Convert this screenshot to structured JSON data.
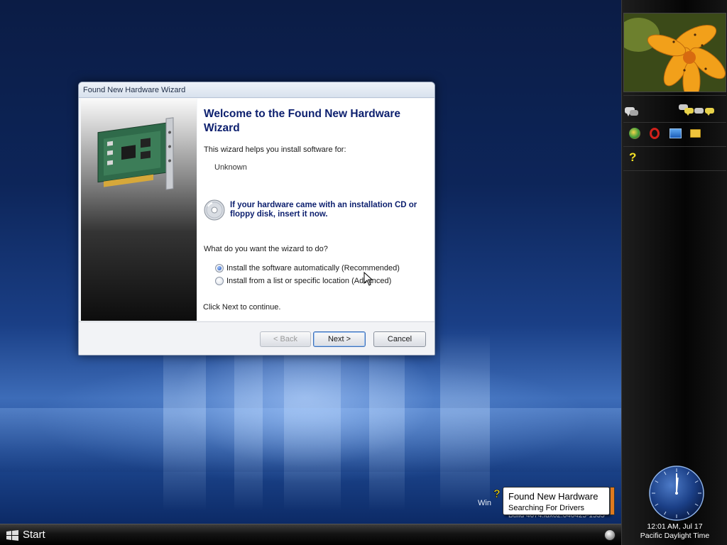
{
  "wizard": {
    "title": "Found New Hardware Wizard",
    "heading": "Welcome to the Found New Hardware Wizard",
    "intro": "This wizard helps you install software for:",
    "device_name": "Unknown",
    "cd_prompt": "If your hardware came with an installation CD or floppy disk, insert it now.",
    "question": "What do you want the wizard to do?",
    "options": [
      {
        "label": "Install the software automatically (Recommended)",
        "selected": true
      },
      {
        "label": "Install from a list or specific location (Advanced)",
        "selected": false
      }
    ],
    "continue_hint": "Click Next to continue.",
    "buttons": {
      "back": "< Back",
      "next": "Next >",
      "cancel": "Cancel"
    }
  },
  "taskbar": {
    "start_label": "Start"
  },
  "notification": {
    "title": "Found New Hardware",
    "body": "Searching For Drivers",
    "behind_text_a": "Win",
    "behind_text_b": "Build 4074.idx02.040425-1535"
  },
  "sidebar": {
    "icons": [
      "chat-icon",
      "contacts-icon",
      "chrome-icon",
      "opera-icon",
      "monitor-icon",
      "folder-icon",
      "help-icon"
    ],
    "clock": {
      "time_date": "12:01 AM, Jul 17",
      "timezone": "Pacific Daylight Time"
    }
  },
  "colors": {
    "heading_blue": "#0c1f6e",
    "balloon_accent": "#e07a1e"
  }
}
